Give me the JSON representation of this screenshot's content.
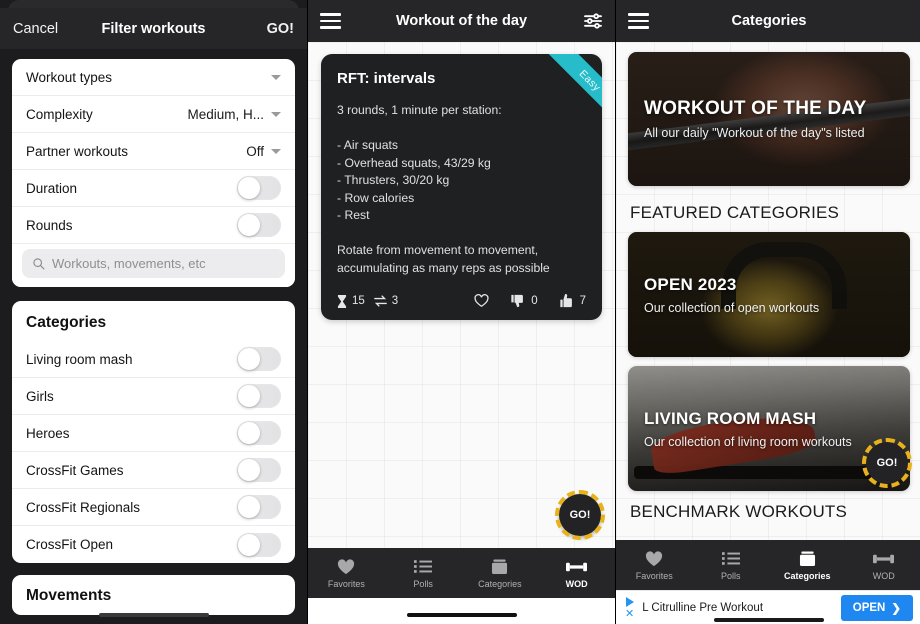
{
  "filter_panel": {
    "header": {
      "cancel_label": "Cancel",
      "title": "Filter workouts",
      "go_label": "GO!"
    },
    "rows": [
      {
        "label": "Workout types",
        "value": "",
        "control": "caret"
      },
      {
        "label": "Complexity",
        "value": "Medium, H...",
        "control": "caret"
      },
      {
        "label": "Partner workouts",
        "value": "Off",
        "control": "caret"
      },
      {
        "label": "Duration",
        "value": "",
        "control": "toggle"
      },
      {
        "label": "Rounds",
        "value": "",
        "control": "toggle"
      }
    ],
    "search": {
      "placeholder": "Workouts, movements, etc",
      "value": ""
    },
    "categories_section": {
      "title": "Categories",
      "items": [
        {
          "label": "Living room mash",
          "on": false
        },
        {
          "label": "Girls",
          "on": false
        },
        {
          "label": "Heroes",
          "on": false
        },
        {
          "label": "CrossFit Games",
          "on": false
        },
        {
          "label": "CrossFit Regionals",
          "on": false
        },
        {
          "label": "CrossFit Open",
          "on": false
        }
      ]
    },
    "movements_section": {
      "title": "Movements"
    }
  },
  "wod_panel": {
    "header": {
      "title": "Workout of the day",
      "menu_icon": "hamburger-icon",
      "filter_icon": "sliders-icon"
    },
    "card": {
      "badge": "Easy",
      "badge_color": "#26bcc9",
      "title": "RFT: intervals",
      "body": "3 rounds, 1 minute per station:\n\n- Air squats\n- Overhead squats, 43/29 kg\n- Thrusters, 30/20 kg\n- Row calories\n- Rest\n\nRotate from movement to movement,\naccumulating as many reps as possible",
      "duration_minutes": "15",
      "rounds": "3",
      "dislikes": "0",
      "likes": "7"
    },
    "fab_label": "GO!",
    "fab_ring_color": "#e8b21d",
    "tabs": [
      {
        "label": "Favorites",
        "icon": "heart-icon",
        "active": false
      },
      {
        "label": "Polls",
        "icon": "list-icon",
        "active": false
      },
      {
        "label": "Categories",
        "icon": "folder-icon",
        "active": false
      },
      {
        "label": "WOD",
        "icon": "dumbbell-icon",
        "active": true
      }
    ]
  },
  "categories_panel": {
    "header": {
      "title": "Categories",
      "menu_icon": "hamburger-icon"
    },
    "hero": {
      "title": "WORKOUT OF THE DAY",
      "subtitle": "All our daily \"Workout of the day\"s listed"
    },
    "featured_heading": "FEATURED CATEGORIES",
    "featured": [
      {
        "title": "OPEN 2023",
        "subtitle": "Our collection of open workouts"
      },
      {
        "title": "LIVING ROOM MASH",
        "subtitle": "Our collection of living room workouts"
      }
    ],
    "benchmark_heading": "BENCHMARK WORKOUTS",
    "fab_label": "GO!",
    "tabs": [
      {
        "label": "Favorites",
        "icon": "heart-icon",
        "active": false
      },
      {
        "label": "Polls",
        "icon": "list-icon",
        "active": false
      },
      {
        "label": "Categories",
        "icon": "folder-icon",
        "active": true
      },
      {
        "label": "WOD",
        "icon": "dumbbell-icon",
        "active": false
      }
    ],
    "ad": {
      "text": "L Citrulline Pre Workout",
      "cta": "OPEN",
      "cta_color": "#1e88f0"
    }
  }
}
